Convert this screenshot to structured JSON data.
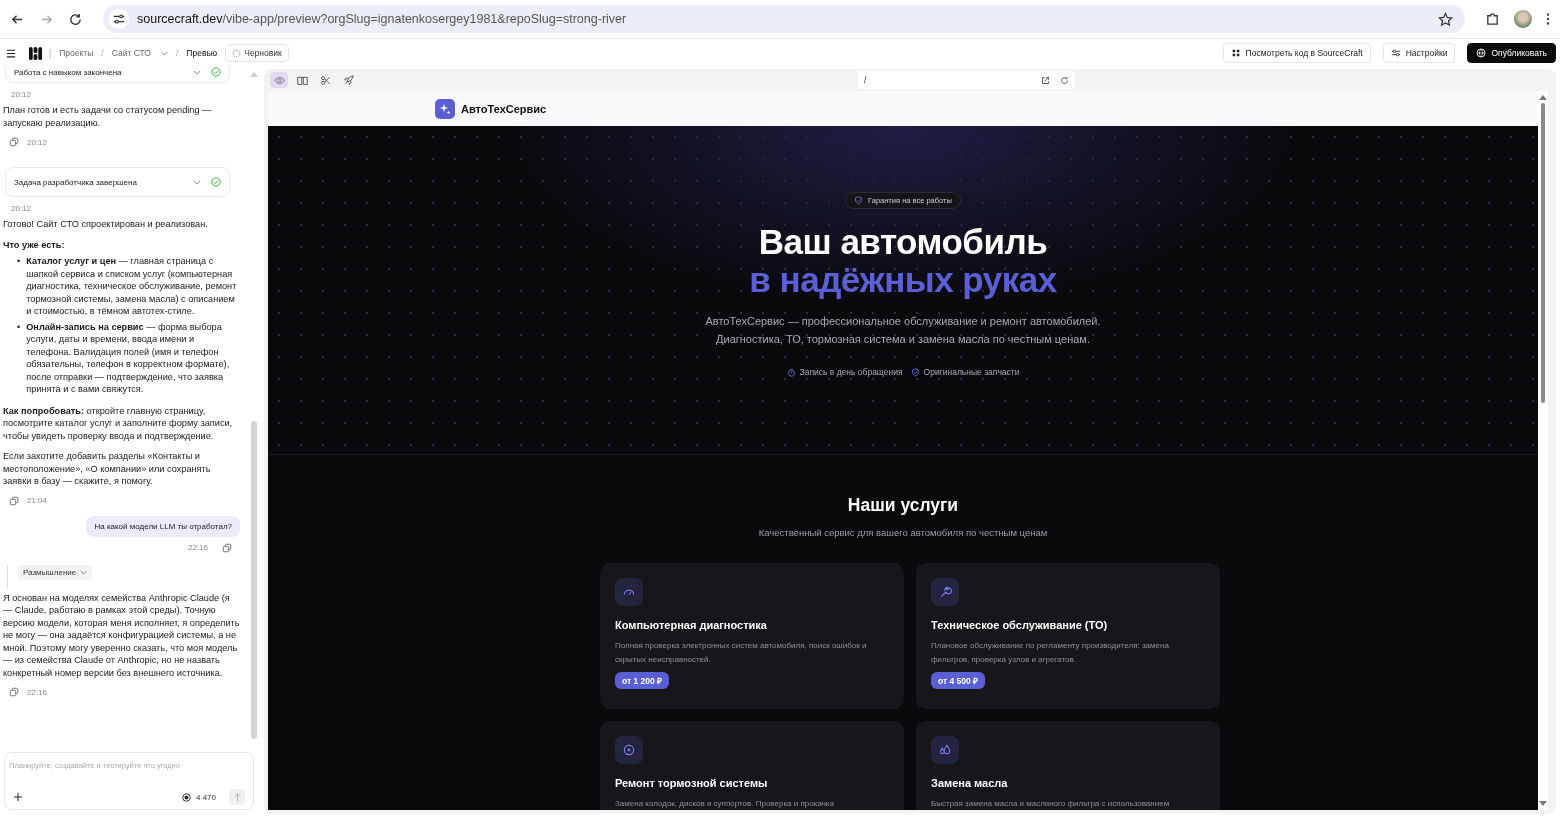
{
  "browser": {
    "url_domain": "sourcecraft.dev",
    "url_path": "/vibe-app/preview?orgSlug=ignatenkosergey1981&repoSlug=strong-river"
  },
  "app_header": {
    "divider": "|",
    "breadcrumbs": [
      {
        "text": "Проекты",
        "kind": "link"
      },
      {
        "text": "/",
        "kind": "separator"
      },
      {
        "text": "Сайт СТО",
        "kind": "dropdown"
      },
      {
        "text": "/",
        "kind": "separator"
      },
      {
        "text": "Превью",
        "kind": "current"
      }
    ],
    "status_chip": "Черновик",
    "actions": [
      {
        "label": "Посмотреть код в SourceCraft",
        "kind": "code",
        "primary": false
      },
      {
        "label": "Настройки",
        "kind": "settings",
        "primary": false
      },
      {
        "label": "Опубликовать",
        "kind": "publish",
        "primary": true
      }
    ]
  },
  "chat": {
    "messages": [
      {
        "kind": "status",
        "text": "Работа с навыком закончена",
        "done": true
      },
      {
        "kind": "time",
        "time": "20:12"
      },
      {
        "kind": "text",
        "text": "План готов и есть задачи со статусом pending — запускаю реализацию."
      },
      {
        "kind": "meta",
        "time": "20:12"
      },
      {
        "kind": "status",
        "text": "Задача разработчика завершена",
        "done": true
      },
      {
        "kind": "time",
        "time": "20:12"
      },
      {
        "kind": "text",
        "text": "Готово! Сайт СТО спроектирован и реализован."
      },
      {
        "kind": "heading",
        "text": "Что уже есть:"
      },
      {
        "kind": "list",
        "items": [
          {
            "marker": "•",
            "text": "**Каталог услуг и цен** — главная страница с шапкой сервиса и списком услуг (компьютерная диагностика, техническое обслуживание, ремонт тормозной системы, замена масла) с описанием и стоимостью, в тёмном автотех-стиле."
          },
          {
            "marker": "•",
            "text": "**Онлайн-запись на сервис** — форма выбора услуги, даты и времени, ввода имени и телефона. Валидация полей (имя и телефон обязательны, телефон в корректном формате), после отправки — подтверждение, что заявка принята и с вами свяжутся."
          }
        ]
      },
      {
        "kind": "text",
        "text": "**Как попробовать:** откройте главную страницу, посмотрите каталог услуг и заполните форму записи, чтобы увидеть проверку ввода и подтверждение."
      },
      {
        "kind": "text",
        "text": "Если захотите добавить разделы «Контакты и местоположение», «О компании» или сохранять заявки в базу — скажите, я помогу."
      },
      {
        "kind": "meta",
        "time": "21:04"
      },
      {
        "kind": "user",
        "text": "На какой модели LLM ты отработал?"
      },
      {
        "kind": "usermeta",
        "time": "22:16"
      },
      {
        "kind": "thinking",
        "text": "Размышление"
      },
      {
        "kind": "text",
        "text": "Я основан на моделях семейства Anthropic Claude (я — Claude, работаю в рамках этой среды). Точную версию модели, которая меня исполняет, я определить не могу — она задаётся конфигурацией системы, а не мной. Поэтому могу уверенно сказать, что моя модель — из семейства Claude от Anthropic, но не назвать конкретный номер версии без внешнего источника."
      },
      {
        "kind": "meta",
        "time": "22:16"
      }
    ],
    "composer": {
      "placeholder": "Планируйте, создавайте и тестируйте что угодно",
      "credits": "4 470"
    }
  },
  "preview": {
    "tools": [
      {
        "kind": "eye",
        "selected": true
      },
      {
        "kind": "book",
        "selected": false
      },
      {
        "kind": "scissors",
        "selected": false
      },
      {
        "kind": "rocket",
        "selected": false
      }
    ],
    "path": "/",
    "site": {
      "brand": "АвтоТехСервис",
      "badge": "Гарантия на все работы",
      "title": "Ваш автомобиль",
      "title_accent": "в надёжных руках",
      "lead": [
        "АвтоТехСервис — профессиональное обслуживание и ремонт автомобилей.",
        "Диагностика, ТО, тормозная система и замена масла по честным ценам."
      ],
      "features": [
        {
          "kind": "timer",
          "text": "Запись в день обращения"
        },
        {
          "kind": "shield",
          "text": "Оригинальные запчасти"
        }
      ],
      "services_title": "Наши услуги",
      "services_subtitle": "Качественный сервис для вашего автомобиля по честным ценам",
      "services": [
        {
          "kind": "gauge",
          "title": "Компьютерная диагностика",
          "text": "Полная проверка электронных систем автомобиля, поиск ошибок и скрытых неисправностей.",
          "price": "от 1 200 ₽"
        },
        {
          "kind": "wrench",
          "title": "Техническое обслуживание (ТО)",
          "text": "Плановое обслуживание по регламенту производителя: замена фильтров, проверка узлов и агрегатов.",
          "price": "от 4 500 ₽"
        },
        {
          "kind": "disc",
          "title": "Ремонт тормозной системы",
          "text": "Замена колодок, дисков и суппортов. Проверка и прокачка"
        },
        {
          "kind": "drops",
          "title": "Замена масла",
          "text": "Быстрая замена масла и масляного фильтра с использованием"
        }
      ]
    }
  }
}
